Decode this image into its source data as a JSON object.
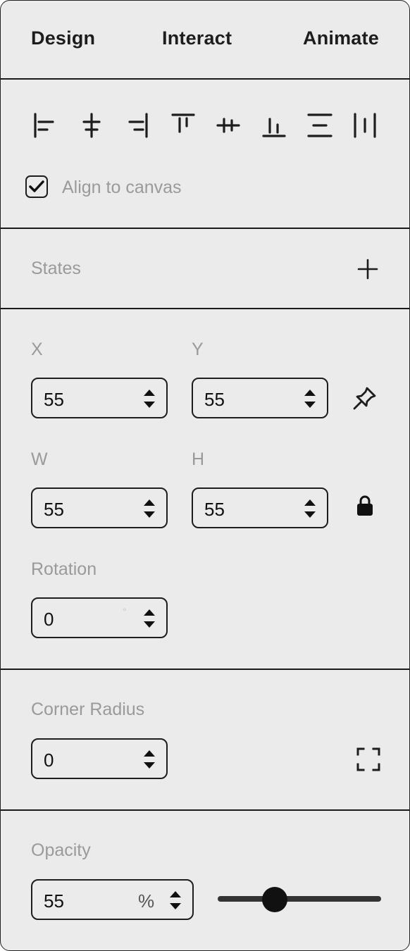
{
  "tabs": [
    "Design",
    "Interact",
    "Animate"
  ],
  "align": {
    "icons": [
      "align-left-icon",
      "align-horizontal-center-icon",
      "align-right-icon",
      "align-top-icon",
      "align-vertical-center-icon",
      "align-bottom-icon",
      "distribute-vertical-icon",
      "distribute-horizontal-icon"
    ],
    "align_to_canvas_label": "Align to canvas",
    "align_to_canvas_checked": true
  },
  "states": {
    "label": "States",
    "add_icon": "plus-icon"
  },
  "position": {
    "x_label": "X",
    "x_value": "55",
    "y_label": "Y",
    "y_value": "55",
    "w_label": "W",
    "w_value": "55",
    "h_label": "H",
    "h_value": "55",
    "pin_icon": "pin-icon",
    "lock_icon": "lock-icon",
    "rotation_label": "Rotation",
    "rotation_value": "0",
    "rotation_unit": "°"
  },
  "corner": {
    "label": "Corner Radius",
    "value": "0",
    "expand_icon": "corners-icon"
  },
  "opacity": {
    "label": "Opacity",
    "value": "55",
    "unit": "%",
    "slider_fraction": 0.35
  },
  "colors": {
    "panel_bg": "#ebebeb",
    "text": "#1d1d1d",
    "muted": "#9a9a9a"
  }
}
